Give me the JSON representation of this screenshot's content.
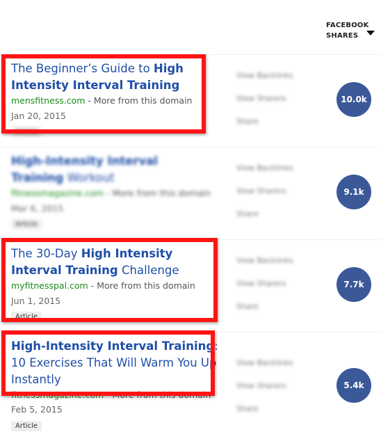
{
  "header": {
    "column_title_line1": "FACEBOOK",
    "column_title_line2": "SHARES",
    "sort_icon": "triangle-down-icon"
  },
  "actions": {
    "backlinks": "View Backlinks",
    "sharers": "View Sharers",
    "share": "Share"
  },
  "results": [
    {
      "title_pre": "The Beginner’s Guide to ",
      "title_bold": "High Intensity Interval Training",
      "title_post": "",
      "domain": "mensfitness.com",
      "more": " - More from this domain",
      "date": "Jan 20, 2015",
      "badge": "Article",
      "shares": "10.0k"
    },
    {
      "title_pre": "",
      "title_bold": "High-Intensity Interval Training",
      "title_post": " Workout",
      "domain": "fitnessmagazine.com",
      "more": " - More from this domain",
      "date": "Mar 6, 2015",
      "badge": "Article",
      "shares": "9.1k"
    },
    {
      "title_pre": "The 30-Day ",
      "title_bold": "High Intensity Interval Training",
      "title_post": " Challenge",
      "domain": "myfitnesspal.com",
      "more": " - More from this domain",
      "date": "Jun 1, 2015",
      "badge": "Article",
      "shares": "7.7k"
    },
    {
      "title_pre": "",
      "title_bold": "High-Intensity Interval Training",
      "title_post": ": 10 Exercises That Will Warm You Up Instantly",
      "domain": "fitnessmagazine.com",
      "more": " - More from this domain",
      "date": "Feb 5, 2015",
      "badge": "Article",
      "shares": "5.4k"
    }
  ],
  "colors": {
    "highlight_box": "#ff1414",
    "share_circle": "#3b5998",
    "title_link": "#1f4fa8",
    "domain": "#1a8a1a"
  }
}
